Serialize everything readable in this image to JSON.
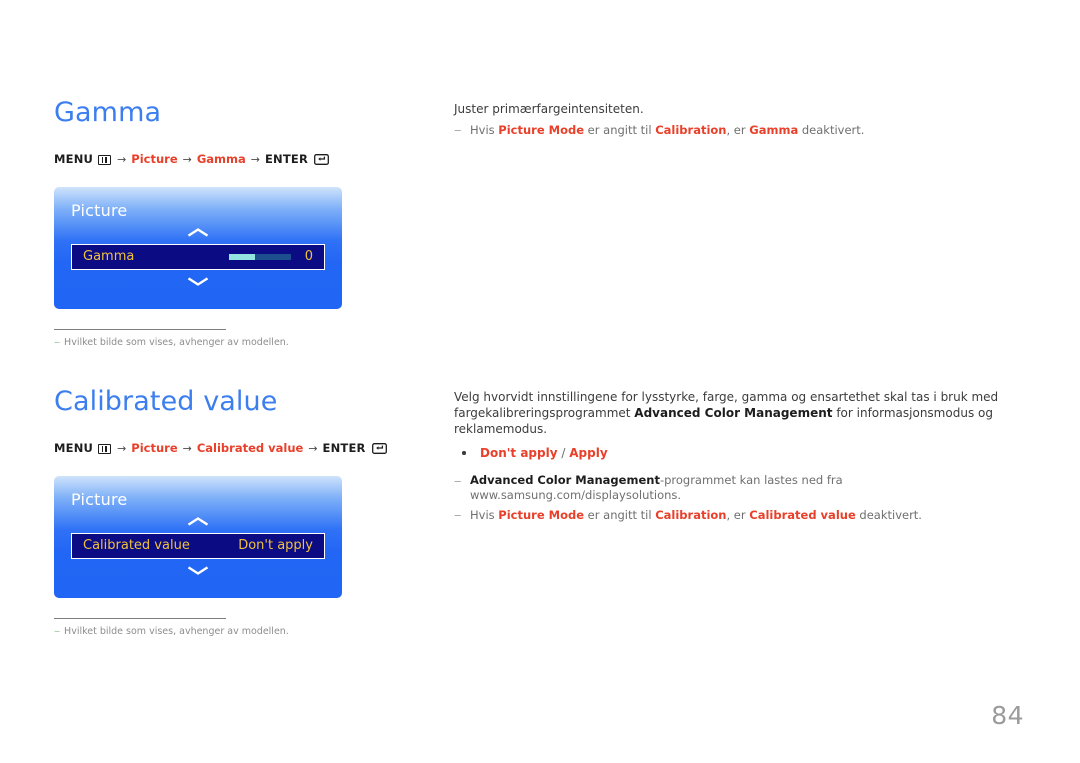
{
  "page": {
    "number": "84",
    "background": "#ffffff",
    "heading_color": "#3c7ef0",
    "accent_red": "#e8402a",
    "osd_blue": "#2266f5",
    "osd_row_bg": "#0b0b84",
    "osd_label_yellow": "#f0c23c"
  },
  "sections": [
    {
      "title": "Gamma",
      "menu_path": {
        "menu_label": "MENU",
        "menu_icon": "menu-grid-icon",
        "arrow": "→",
        "step1": "Picture",
        "step2": "Gamma",
        "enter_label": "ENTER",
        "enter_icon": "enter-return-icon"
      },
      "osd": {
        "title": "Picture",
        "chevron_up": "chevron-up-icon",
        "chevron_down": "chevron-down-icon",
        "row_label": "Gamma",
        "row_value": "0",
        "slider_fill_percent": 42,
        "slider_fill_color": "#93e6df",
        "slider_track_color": "#1d4f8f"
      },
      "footnote": {
        "dash": "‒",
        "text": "Hvilket bilde som vises, avhenger av modellen."
      },
      "right": {
        "intro": "Juster primærfargeintensiteten.",
        "notes": [
          {
            "dash": "‒",
            "parts": [
              {
                "text": "Hvis ",
                "style": "plain"
              },
              {
                "text": "Picture Mode",
                "style": "red"
              },
              {
                "text": " er angitt til ",
                "style": "plain"
              },
              {
                "text": "Calibration",
                "style": "red"
              },
              {
                "text": ", er ",
                "style": "plain"
              },
              {
                "text": "Gamma",
                "style": "red"
              },
              {
                "text": " deaktivert.",
                "style": "plain"
              }
            ]
          }
        ]
      }
    },
    {
      "title": "Calibrated value",
      "menu_path": {
        "menu_label": "MENU",
        "menu_icon": "menu-grid-icon",
        "arrow": "→",
        "step1": "Picture",
        "step2": "Calibrated value",
        "enter_label": "ENTER",
        "enter_icon": "enter-return-icon"
      },
      "osd": {
        "title": "Picture",
        "chevron_up": "chevron-up-icon",
        "chevron_down": "chevron-down-icon",
        "row_label": "Calibrated value",
        "row_value": "Don't apply"
      },
      "footnote": {
        "dash": "‒",
        "text": "Hvilket bilde som vises, avhenger av modellen."
      },
      "right": {
        "intro_parts": [
          {
            "text": "Velg hvorvidt innstillingene for lysstyrke, farge, gamma og ensartethet skal tas i bruk med fargekalibreringsprogrammet ",
            "style": "plain"
          },
          {
            "text": "Advanced Color Management",
            "style": "bold"
          },
          {
            "text": " for informasjonsmodus og reklamemodus.",
            "style": "plain"
          }
        ],
        "bullet": {
          "option1": "Don't apply",
          "separator": " / ",
          "option2": "Apply"
        },
        "notes": [
          {
            "dash": "‒",
            "parts": [
              {
                "text": "Advanced Color Management",
                "style": "black-bold"
              },
              {
                "text": "-programmet kan lastes ned fra www.samsung.com/displaysolutions.",
                "style": "plain"
              }
            ]
          },
          {
            "dash": "‒",
            "parts": [
              {
                "text": "Hvis ",
                "style": "plain"
              },
              {
                "text": "Picture Mode",
                "style": "red"
              },
              {
                "text": " er angitt til ",
                "style": "plain"
              },
              {
                "text": "Calibration",
                "style": "red"
              },
              {
                "text": ", er ",
                "style": "plain"
              },
              {
                "text": "Calibrated value",
                "style": "red"
              },
              {
                "text": " deaktivert.",
                "style": "plain"
              }
            ]
          }
        ]
      }
    }
  ]
}
